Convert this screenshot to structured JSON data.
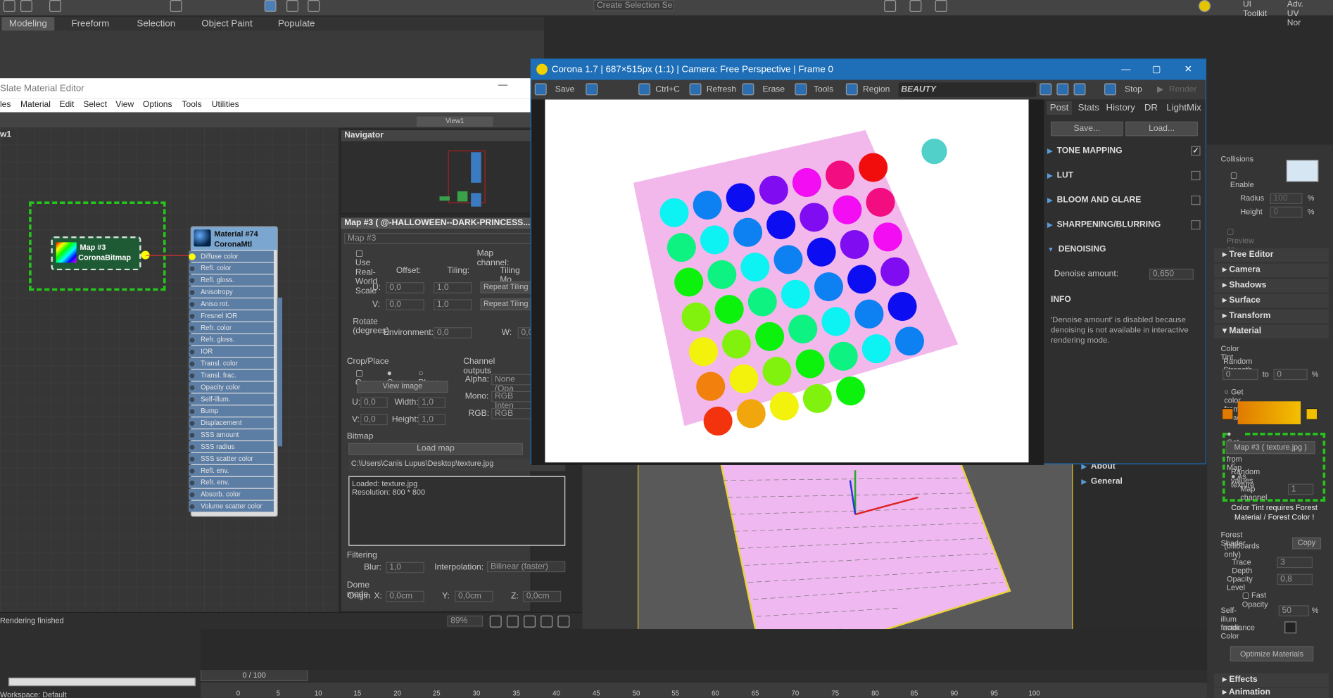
{
  "ribbon": {
    "tabs": [
      "Modeling",
      "Freeform",
      "Selection",
      "Object Paint",
      "Populate"
    ],
    "selection_box": "Create Selection Se",
    "top_right": [
      "UI Toolkit",
      "Adv. UV Nor"
    ]
  },
  "sme": {
    "title": "Slate Material Editor",
    "menu": [
      "les",
      "Material",
      "Edit",
      "Select",
      "View",
      "Options",
      "Tools",
      "Utilities"
    ],
    "view_tab": "View1",
    "view_label": "w1",
    "navigator": "Navigator",
    "status": "Rendering finished",
    "zoom": "89%",
    "node_map": {
      "name": "Map #3",
      "type": "CoronaBitmap"
    },
    "node_mtl": {
      "name": "Material #74",
      "type": "CoronaMtl"
    },
    "slots": [
      "Diffuse color",
      "Refl. color",
      "Refl. gloss.",
      "Anisotropy",
      "Aniso rot.",
      "Fresnel IOR",
      "Refr. color",
      "Refr. gloss.",
      "IOR",
      "Transl. color",
      "Transl. frac.",
      "Opacity color",
      "Self-illum.",
      "Bump",
      "Displacement",
      "SSS amount",
      "SSS radius",
      "SSS scatter color",
      "Refl. env.",
      "Refr. env.",
      "Absorb. color",
      "Volume scatter color"
    ]
  },
  "params": {
    "header": "Map #3  ( @-HALLOWEEN--DARK-PRINCESS...",
    "name_field": "Map #3",
    "use_real_world": "Use Real-World Scale",
    "map_channel": "Map channel:",
    "offset": "Offset:",
    "tiling": "Tiling:",
    "tiling_mode": "Tiling Mo",
    "u": "U:",
    "v": "V:",
    "u_offset": "0,0",
    "v_offset": "0,0",
    "u_tiling": "1,0",
    "v_tiling": "1,0",
    "repeat_u": "Repeat Tiling",
    "repeat_v": "Repeat Tiling",
    "rotate": "Rotate (degrees)",
    "environment": "Environment:",
    "env_val": "0,0",
    "w": "W:",
    "w_val": "0,0",
    "crop_place": "Crop/Place",
    "on": "On",
    "crop": "Crop",
    "place": "Place",
    "view_image": "View Image",
    "u_c": "0,0",
    "v_c": "0,0",
    "width": "Width:",
    "height": "Height:",
    "width_val": "1,0",
    "height_val": "1,0",
    "channel_outputs": "Channel outputs",
    "alpha": "Alpha:",
    "alpha_val": "None (Opa",
    "mono": "Mono:",
    "mono_val": "RGB Inten",
    "rgb": "RGB:",
    "rgb_val": "RGB",
    "bitmap": "Bitmap",
    "load_map": "Load map",
    "path": "C:\\Users\\Canis Lupus\\Desktop\\texture.jpg",
    "loaded": "Loaded: texture.jpg",
    "resolution": "Resolution: 800 * 800",
    "filtering": "Filtering",
    "blur": "Blur:",
    "blur_val": "1,0",
    "interpolation": "Interpolation:",
    "interp_val": "Bilinear (faster)",
    "dome": "Dome mode",
    "origin": "Origin",
    "x": "X:",
    "y": "Y:",
    "z": "Z:",
    "ox": "0,0cm",
    "oy": "0,0cm",
    "oz": "0,0cm"
  },
  "vfb": {
    "title": "Corona 1.7 | 687×515px (1:1) | Camera: Free Perspective | Frame 0",
    "toolbar": [
      "Save",
      "Ctrl+C",
      "Refresh",
      "Erase",
      "Tools",
      "Region"
    ],
    "pass": "BEAUTY",
    "stop": "Stop",
    "render": "Render",
    "tabs": [
      "Post",
      "Stats",
      "History",
      "DR",
      "LightMix"
    ],
    "save_btn": "Save...",
    "load_btn": "Load...",
    "sections": [
      "TONE MAPPING",
      "LUT",
      "BLOOM AND GLARE",
      "SHARPENING/BLURRING",
      "DENOISING"
    ],
    "denoise_label": "Denoise amount:",
    "denoise_val": "0,650",
    "info_title": "INFO",
    "info_text": "'Denoise amount' is disabled because denoising is not available in interactive rendering mode."
  },
  "viewport": {
    "about": "About",
    "general": "General"
  },
  "timeline": {
    "frame": "0 / 100",
    "ticks": [
      "0",
      "5",
      "10",
      "15",
      "20",
      "25",
      "30",
      "35",
      "40",
      "45",
      "50",
      "55",
      "60",
      "65",
      "70",
      "75",
      "80",
      "85",
      "90",
      "95",
      "100"
    ],
    "workspace": "Workspace: Default"
  },
  "panel": {
    "collisions": "Collisions",
    "enable": "Enable",
    "radius": "Radius",
    "radius_val": "100",
    "height": "Height",
    "height_val": "0",
    "pct": "%",
    "preview": "Preview on Viewport",
    "rollouts": [
      "Tree Editor",
      "Camera",
      "Shadows",
      "Surface",
      "Transform",
      "Material"
    ],
    "color_tint": "Color Tint",
    "random_strength": "Random Strength",
    "rs_from": "0",
    "to": "to",
    "rs_to": "0",
    "from_gradient": "Get color from Gradient",
    "from_map": "Get color from Map",
    "map_btn": "Map #3  ( texture.jpg )",
    "random_values": "Random values",
    "as_texture": "As texture",
    "map_channel": "Map channel",
    "map_channel_val": "1",
    "tint_note": "Color Tint requires Forest Material / Forest Color !",
    "forest_shader": "Forest Shader",
    "billboards": "(billboards only)",
    "copy": "Copy",
    "trace_depth": "Trace Depth",
    "trace_val": "3",
    "opacity_level": "Opacity Level",
    "opacity_val": "0,8",
    "fast_opacity": "Fast Opacity",
    "selfillum": "Self-illum factor",
    "selfillum_val": "50",
    "irradiance": "Irradiance Color",
    "optimize": "Optimize Materials",
    "effects": "Effects",
    "animation": "Animation"
  },
  "colors": {
    "accent": "#1e6fb8",
    "highlight": "#27c21b",
    "plane": "#f0b8f0"
  }
}
